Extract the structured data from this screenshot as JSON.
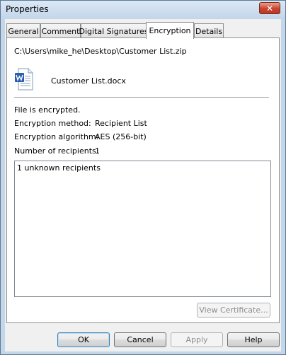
{
  "window": {
    "title": "Properties",
    "close_label": "✕"
  },
  "tabs": [
    {
      "label": "General"
    },
    {
      "label": "Comment"
    },
    {
      "label": "Digital Signatures"
    },
    {
      "label": "Encryption",
      "active": true
    },
    {
      "label": "Details"
    }
  ],
  "encryption": {
    "path": "C:\\Users\\mike_he\\Desktop\\Customer List.zip",
    "file_icon": "word-document-icon",
    "filename": "Customer List.docx",
    "status": "File is encrypted.",
    "method_label": "Encryption method:",
    "method_value": "Recipient List",
    "algorithm_label": "Encryption algorithm:",
    "algorithm_value": "AES (256-bit)",
    "recipients_label": "Number of recipients:",
    "recipients_value": "1",
    "recipients_list": [
      "1 unknown recipients"
    ],
    "view_certificate": "View Certificate..."
  },
  "buttons": {
    "ok": "OK",
    "cancel": "Cancel",
    "apply": "Apply",
    "help": "Help"
  }
}
